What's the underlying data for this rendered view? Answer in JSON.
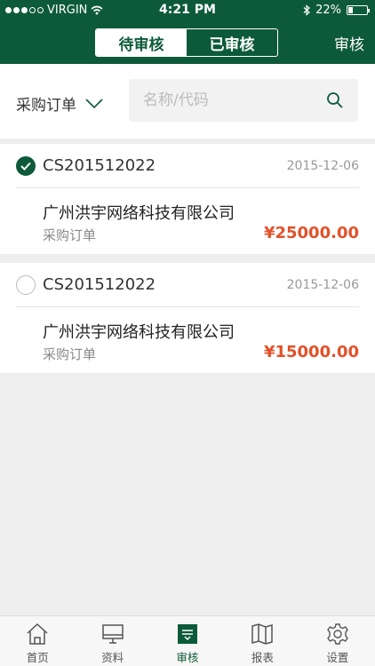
{
  "status_bar": {
    "carrier": "VIRGIN",
    "time": "4:21 PM",
    "battery": "22%"
  },
  "header": {
    "segments": [
      {
        "label": "待审核",
        "active": true
      },
      {
        "label": "已审核",
        "active": false
      }
    ],
    "action_label": "审核",
    "bg_color": "#0d5a3a"
  },
  "filter": {
    "type_selected": "采购订单",
    "search_placeholder": "名称/代码"
  },
  "orders": [
    {
      "checked": true,
      "order_no": "CS201512022",
      "date": "2015-12-06",
      "company": "广州洪宇网络科技有限公司",
      "type": "采购订单",
      "amount": "¥25000.00"
    },
    {
      "checked": false,
      "order_no": "CS201512022",
      "date": "2015-12-06",
      "company": "广州洪宇网络科技有限公司",
      "type": "采购订单",
      "amount": "¥15000.00"
    }
  ],
  "tabbar": {
    "tabs": [
      {
        "label": "首页",
        "icon": "home-icon",
        "active": false
      },
      {
        "label": "资料",
        "icon": "monitor-icon",
        "active": false
      },
      {
        "label": "审核",
        "icon": "review-icon",
        "active": true
      },
      {
        "label": "报表",
        "icon": "map-icon",
        "active": false
      },
      {
        "label": "设置",
        "icon": "gear-icon",
        "active": false
      }
    ]
  },
  "colors": {
    "brand": "#0d5a3a",
    "amount": "#e2512a"
  }
}
